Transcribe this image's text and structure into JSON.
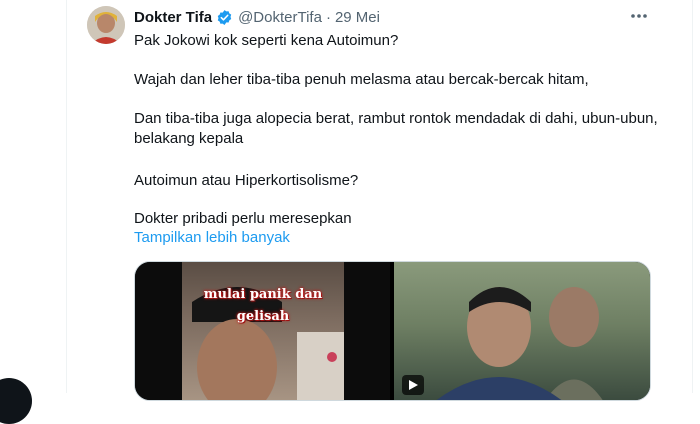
{
  "tweet": {
    "author_name": "Dokter Tifa",
    "handle": "@DokterTifa",
    "separator": "·",
    "date": "29 Mei",
    "more_icon": "more-horizontal-icon",
    "lines": [
      "Pak Jokowi kok seperti kena Autoimun?",
      "Wajah dan leher tiba-tiba penuh melasma atau bercak-bercak hitam,",
      "Dan tiba-tiba juga alopecia berat,  rambut rontok mendadak di dahi, ubun-ubun, belakang kepala",
      "Autoimun atau Hiperkortisolisme?",
      "Dokter pribadi  perlu meresepkan"
    ],
    "show_more": "Tampilkan lebih banyak",
    "media": {
      "overlay_line1": "mulai panik dan",
      "overlay_line2": "gelisah",
      "play_icon": "play-icon"
    }
  },
  "colors": {
    "link": "#1d9bf0",
    "secondary": "#536471",
    "verified": "#1d9bf0",
    "overlay_glow": "#c01818"
  }
}
